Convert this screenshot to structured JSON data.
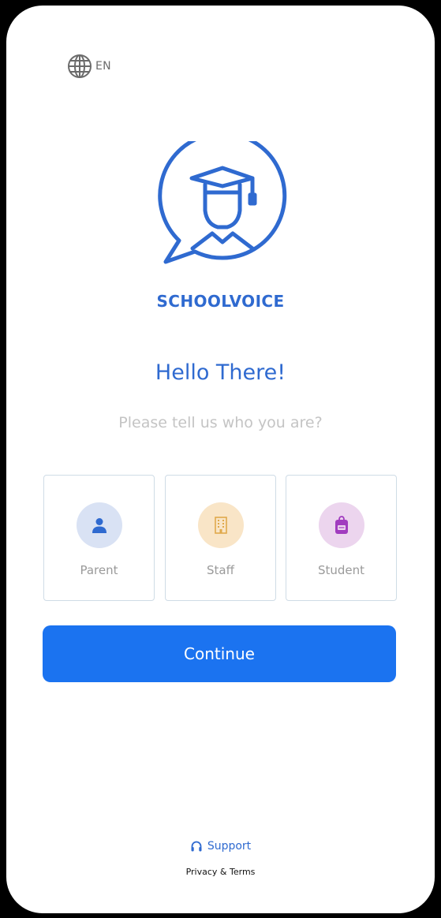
{
  "language": {
    "icon": "globe-icon",
    "label": "EN"
  },
  "brand": {
    "name": "SCHOOLVOICE",
    "logo_icon": "graduate-speech-bubble-icon",
    "color": "#2f6ad0"
  },
  "greeting": {
    "title": "Hello There!",
    "subtitle": "Please tell us who you are?"
  },
  "roles": [
    {
      "label": "Parent",
      "icon": "person-icon",
      "icon_color": "#2f6ad0",
      "bg_color": "#d9e2f4"
    },
    {
      "label": "Staff",
      "icon": "building-icon",
      "icon_color": "#e0a94b",
      "bg_color": "#f9e5c7"
    },
    {
      "label": "Student",
      "icon": "backpack-icon",
      "icon_color": "#a13cbf",
      "bg_color": "#ecd5ee"
    }
  ],
  "actions": {
    "continue_label": "Continue",
    "continue_color": "#1b73f0"
  },
  "footer": {
    "support_label": "Support",
    "support_icon": "headphones-icon",
    "privacy_label": "Privacy & Terms"
  }
}
